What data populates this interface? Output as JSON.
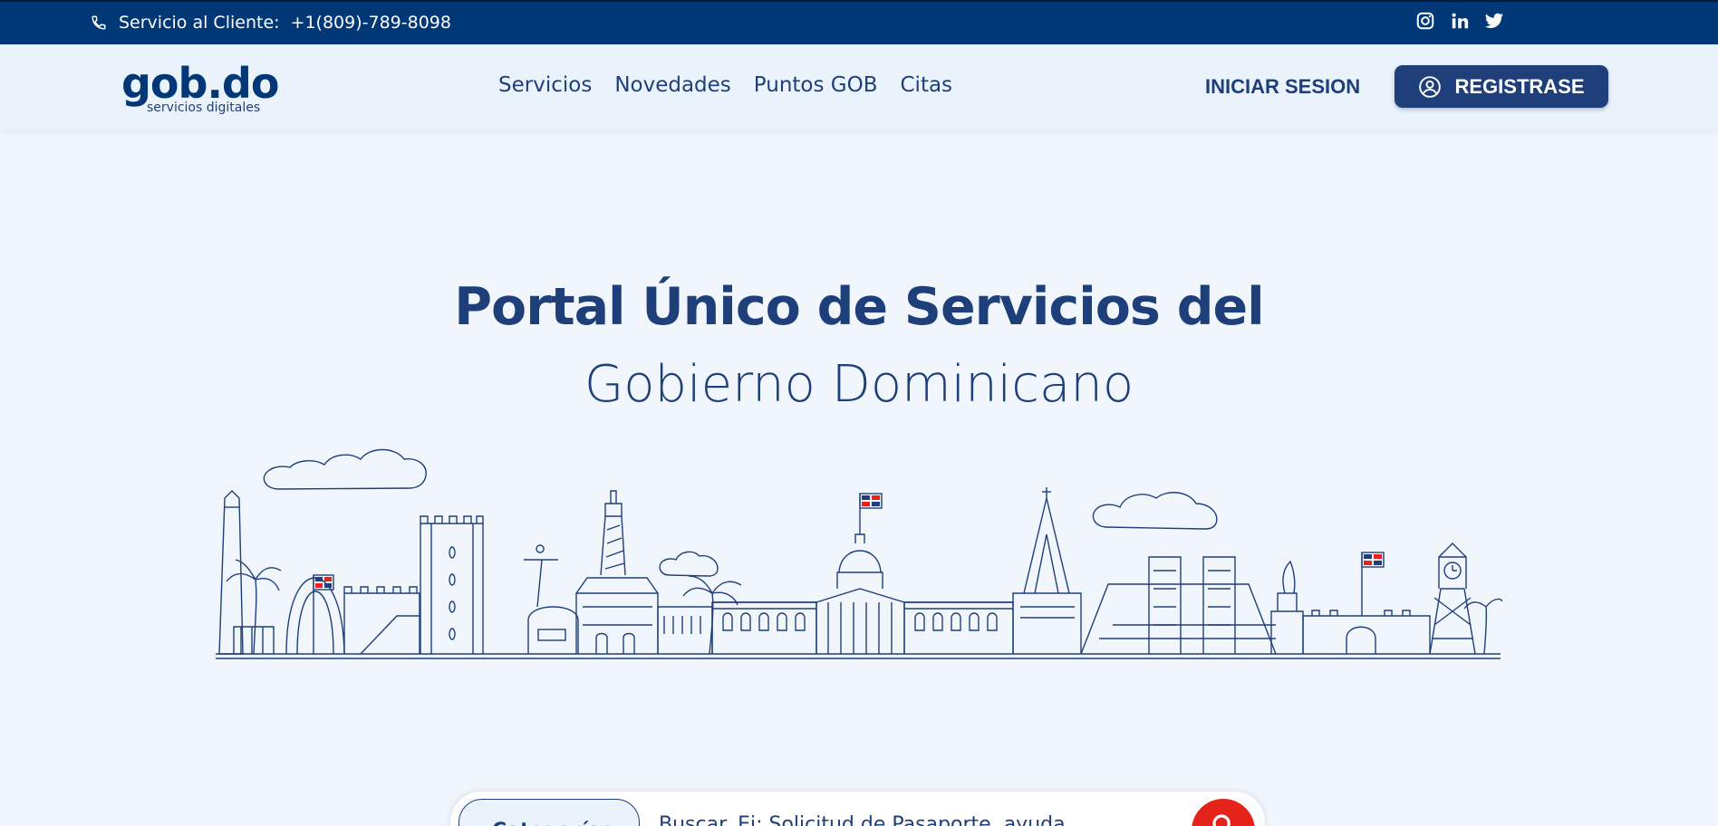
{
  "topbar": {
    "contact_label": "Servicio al Cliente:",
    "phone": "+1(809)-789-8098",
    "icons": [
      "phone-icon",
      "instagram-icon",
      "linkedin-icon",
      "twitter-icon"
    ]
  },
  "header": {
    "logo_text": "gob.do",
    "logo_sub": "servicios digitales",
    "nav": [
      "Servicios",
      "Novedades",
      "Puntos GOB",
      "Citas"
    ],
    "login": "INICIAR SESION",
    "register": "REGISTRASE"
  },
  "hero": {
    "title_line1": "Portal Único de Servicios del",
    "title_line2": "Gobierno Dominicano"
  },
  "search": {
    "category": "Categorías",
    "placeholder": "Buscar. Ej: Solicitud de Pasaporte, ayuda..."
  },
  "colors": {
    "primary": "#1f3f7a",
    "topbar": "#003776",
    "accent": "#e5231b",
    "background": "#f1f6fd"
  }
}
